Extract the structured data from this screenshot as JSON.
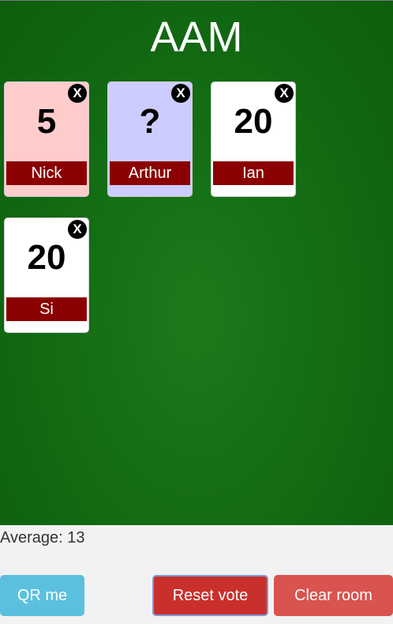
{
  "room": {
    "title": "AAM"
  },
  "cards": [
    {
      "value": "5",
      "name": "Nick",
      "remove_label": "X",
      "bg": "#ffcccc"
    },
    {
      "value": "?",
      "name": "Arthur",
      "remove_label": "X",
      "bg": "#ccccff"
    },
    {
      "value": "20",
      "name": "Ian",
      "remove_label": "X",
      "bg": "#ffffff"
    },
    {
      "value": "20",
      "name": "Si",
      "remove_label": "X",
      "bg": "#ffffff"
    }
  ],
  "stats": {
    "average": "Average: 13"
  },
  "buttons": {
    "qr_label": "QR me",
    "reset_label": "Reset vote",
    "clear_label": "Clear room"
  },
  "colors": {
    "table": "#146d14",
    "name_bar": "#8b0000",
    "qr": "#5bc0de",
    "reset": "#c9302c",
    "clear": "#d9534f"
  }
}
